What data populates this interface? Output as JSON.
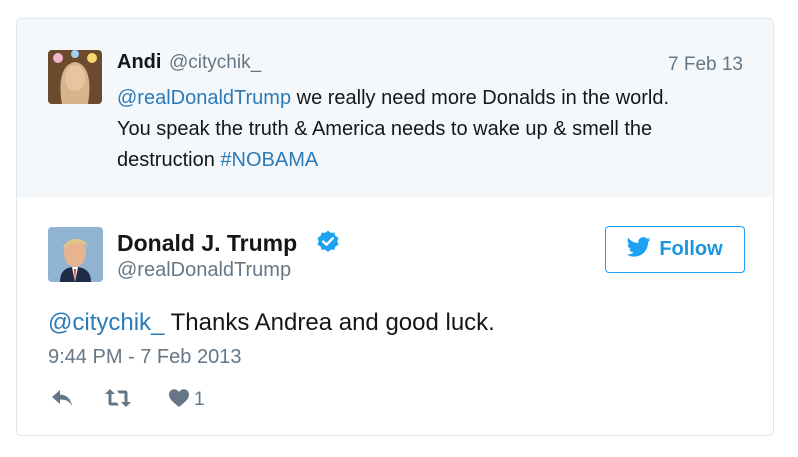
{
  "parent_tweet": {
    "name": "Andi",
    "handle": "@citychik_",
    "date": "7 Feb 13",
    "mention": "@realDonaldTrump",
    "text_line1": " we really need more Donalds in the world.",
    "text_line2": "You speak the truth & America needs to wake up & smell the",
    "text_line3": "destruction ",
    "hashtag": "#NOBAMA"
  },
  "main_tweet": {
    "name": "Donald J. Trump",
    "handle": "@realDonaldTrump",
    "follow_label": "Follow",
    "mention": "@citychik_",
    "text": " Thanks Andrea and good luck.",
    "timestamp": "9:44 PM - 7 Feb 2013",
    "like_count": "1"
  },
  "colors": {
    "link": "#2b7bb9",
    "follow_accent": "#1da1f2",
    "verified": "#1da1f2",
    "muted": "#657786",
    "parent_bg": "#f5f8fa"
  },
  "icons": [
    "verified-badge-icon",
    "twitter-bird-icon",
    "reply-icon",
    "retweet-icon",
    "heart-icon"
  ]
}
